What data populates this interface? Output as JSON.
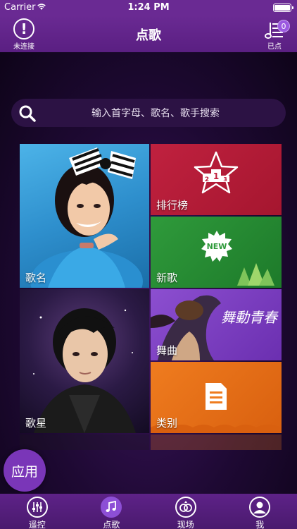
{
  "status_bar": {
    "carrier": "Carrier",
    "time": "1:24 PM"
  },
  "nav": {
    "left_label": "未连接",
    "left_icon_glyph": "!",
    "title": "点歌",
    "right_label": "已点",
    "badge_count": "0"
  },
  "search": {
    "placeholder": "输入首字母、歌名、歌手搜索"
  },
  "tiles": {
    "song_name": "歌名",
    "ranking": "排行榜",
    "new_song": "新歌",
    "new_badge": "NEW",
    "singer": "歌星",
    "dance": "舞曲",
    "dance_art": "舞動青春",
    "category": "类别"
  },
  "app_button": "应用",
  "tab_bar": {
    "tabs": [
      {
        "label": "遥控",
        "icon": "equalizer-icon"
      },
      {
        "label": "点歌",
        "icon": "music-note-icon",
        "active": true
      },
      {
        "label": "现场",
        "icon": "rings-icon"
      },
      {
        "label": "我",
        "icon": "person-icon"
      }
    ]
  },
  "colors": {
    "nav_bg": "#6a2a93",
    "ranking_tile": "#c0213f",
    "new_song_tile": "#2f9a3b",
    "dance_tile": "#8c4fd0",
    "category_tile": "#ef7c1f",
    "song_name_tile": "#4cb3e8",
    "app_button": "#7a36b8",
    "active_tab": "#8d4fd6"
  }
}
